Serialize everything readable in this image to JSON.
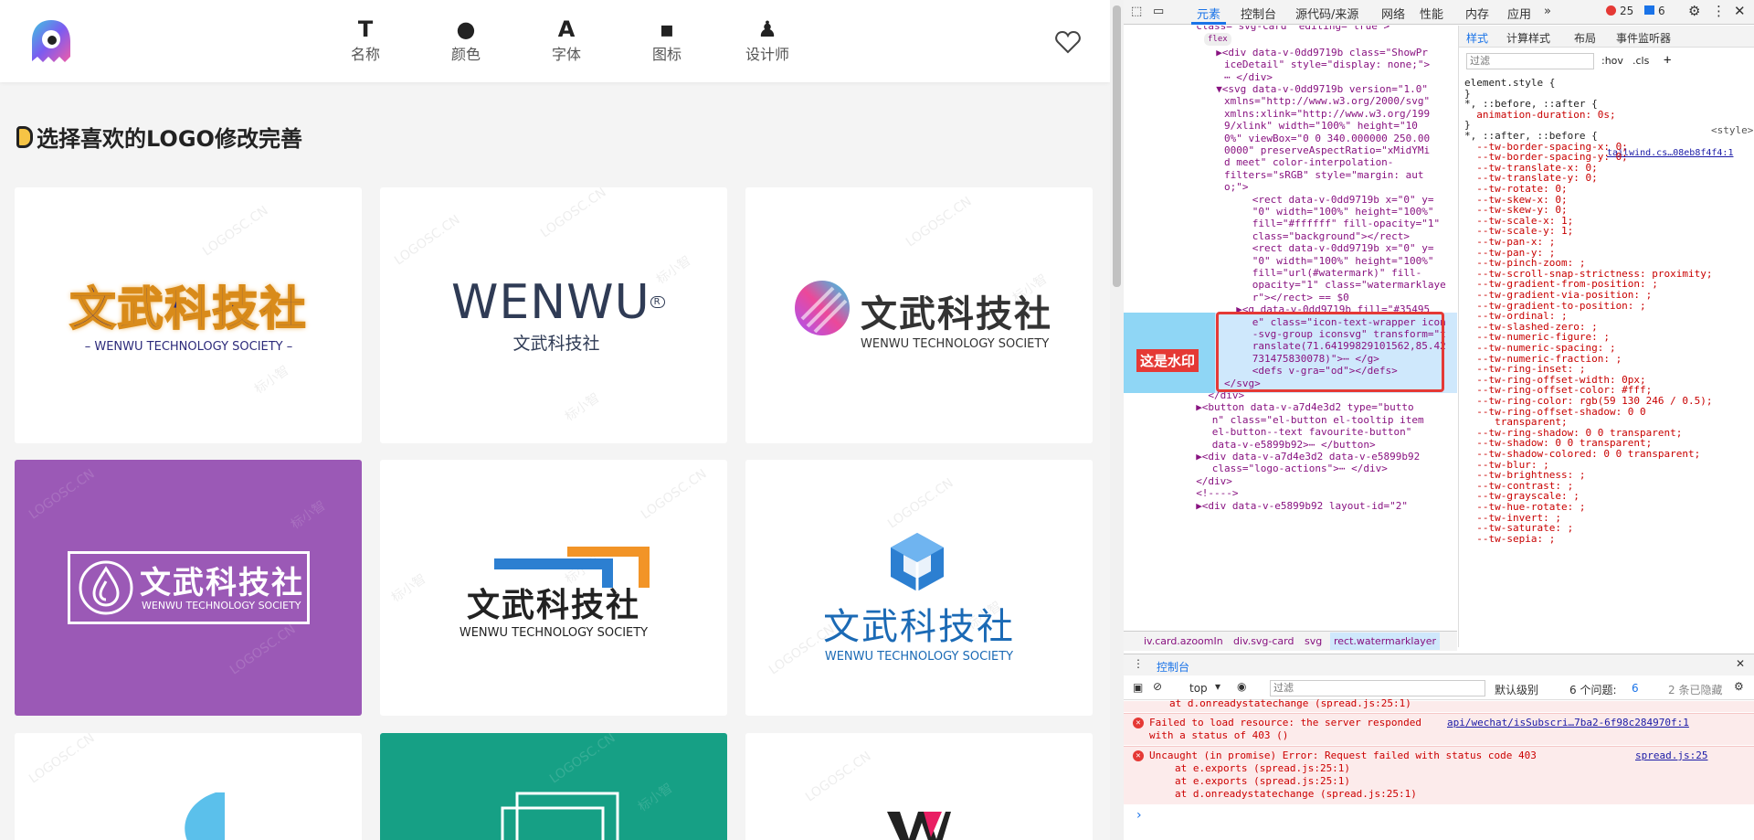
{
  "nav": {
    "items": [
      {
        "icon": "T",
        "label": "名称"
      },
      {
        "icon": "●",
        "label": "颜色"
      },
      {
        "icon": "A",
        "label": "字体"
      },
      {
        "icon": "▪",
        "label": "图标"
      },
      {
        "icon": "♟",
        "label": "设计师"
      }
    ]
  },
  "section": {
    "title": "选择喜欢的LOGO修改完善"
  },
  "watermark": {
    "a": "LOGOSC.CN",
    "b": "标小智"
  },
  "logos": {
    "l1": {
      "cn": "文武科技社",
      "en": "– WENWU TECHNOLOGY SOCIETY –"
    },
    "l2": {
      "brand": "WENWU",
      "reg": "R",
      "cn": "文武科技社"
    },
    "l3": {
      "cn": "文武科技社",
      "en": "WENWU TECHNOLOGY SOCIETY"
    },
    "l4": {
      "cn": "文武科技社",
      "en": "WENWU TECHNOLOGY SOCIETY"
    },
    "l5": {
      "cn": "文武科技社",
      "en": "WENWU TECHNOLOGY SOCIETY"
    },
    "l6": {
      "cn": "文武科技社",
      "en": "WENWU TECHNOLOGY SOCIETY"
    }
  },
  "devtools": {
    "tabs": [
      "元素",
      "控制台",
      "源代码/来源",
      "网络",
      "性能",
      "内存",
      "应用"
    ],
    "more": "»",
    "errors": "25",
    "messages": "6",
    "styles_tabs": [
      "样式",
      "计算样式",
      "布局",
      "事件监听器"
    ],
    "filter_placeholder": "过滤",
    "hov": ":hov",
    "cls": ".cls",
    "watermark_note": "这是水印",
    "code_lines": [
      "class= svg-card  editing= true >",
      "flex",
      "▶<div data-v-0dd9719b class=\"ShowPr",
      "iceDetail\" style=\"display: none;\">",
      "⋯ </div>",
      "▼<svg data-v-0dd9719b version=\"1.0\"",
      "xmlns=\"http://www.w3.org/2000/svg\"",
      "xmlns:xlink=\"http://www.w3.org/199",
      "9/xlink\" width=\"100%\" height=\"10",
      "0%\" viewBox=\"0 0 340.000000 250.00",
      "0000\" preserveAspectRatio=\"xMidYMi",
      "d meet\" color-interpolation-",
      "filters=\"sRGB\" style=\"margin: aut",
      "o;\">",
      "<rect data-v-0dd9719b x=\"0\" y=",
      "\"0\" width=\"100%\" height=\"100%\"",
      "fill=\"#ffffff\" fill-opacity=\"1\"",
      "class=\"background\"></rect>",
      "<rect data-v-0dd9719b x=\"0\" y=",
      "\"0\" width=\"100%\" height=\"100%\"",
      "fill=\"url(#watermark)\" fill-",
      "opacity=\"1\" class=\"watermarklaye",
      "r\"></rect> == $0",
      "▶<g data-v-0dd9719b fill=\"#35495",
      "e\" class=\"icon-text-wrapper icon",
      "-svg-group iconsvg\" transform=\"t",
      "ranslate(71.64199829101562,85.42",
      "731475830078)\">⋯ </g>",
      "<defs v-gra=\"od\"></defs>",
      "</svg>",
      "</div>",
      "▶<button data-v-a7d4e3d2 type=\"butto",
      "n\" class=\"el-button el-tooltip item",
      "el-button--text favourite-button\"",
      "data-v-e5899b92>⋯ </button>",
      "▶<div data-v-a7d4e3d2 data-v-e5899b92",
      "class=\"logo-actions\">⋯ </div>",
      "</div>",
      "<!---->",
      "▶<div data-v-e5899b92 layout-id=\"2\""
    ],
    "style_lines": [
      "element.style {",
      "}",
      "*, ::before, ::after {",
      "  animation-duration: 0s;",
      "}",
      "*, ::after, ::before {",
      "  --tw-border-spacing-x: 0;",
      "  --tw-border-spacing-y: 0;",
      "  --tw-translate-x: 0;",
      "  --tw-translate-y: 0;",
      "  --tw-rotate: 0;",
      "  --tw-skew-x: 0;",
      "  --tw-skew-y: 0;",
      "  --tw-scale-x: 1;",
      "  --tw-scale-y: 1;",
      "  --tw-pan-x: ;",
      "  --tw-pan-y: ;",
      "  --tw-pinch-zoom: ;",
      "  --tw-scroll-snap-strictness: proximity;",
      "  --tw-gradient-from-position: ;",
      "  --tw-gradient-via-position: ;",
      "  --tw-gradient-to-position: ;",
      "  --tw-ordinal: ;",
      "  --tw-slashed-zero: ;",
      "  --tw-numeric-figure: ;",
      "  --tw-numeric-spacing: ;",
      "  --tw-numeric-fraction: ;",
      "  --tw-ring-inset: ;",
      "  --tw-ring-offset-width: 0px;",
      "  --tw-ring-offset-color: #fff;",
      "  --tw-ring-color: rgb(59 130 246 / 0.5);",
      "  --tw-ring-offset-shadow: 0 0",
      "     transparent;",
      "  --tw-ring-shadow: 0 0 transparent;",
      "  --tw-shadow: 0 0 transparent;",
      "  --tw-shadow-colored: 0 0 transparent;",
      "  --tw-blur: ;",
      "  --tw-brightness: ;",
      "  --tw-contrast: ;",
      "  --tw-grayscale: ;",
      "  --tw-hue-rotate: ;",
      "  --tw-invert: ;",
      "  --tw-saturate: ;",
      "  --tw-sepia: ;"
    ],
    "style_source1": "<style>",
    "style_source2": "tailwind.cs…08eb8f4f4:1",
    "crumbs": [
      "iv.card.azoomIn",
      "div.svg-card",
      "svg",
      "rect.watermarklayer"
    ],
    "console": {
      "title": "控制台",
      "context": "top",
      "filter_placeholder": "过滤",
      "level": "默认级别",
      "issues_label": "6 个问题:",
      "issues_count": "6",
      "hidden": "2 条已隐藏",
      "prev_line": "at d.onreadystatechange (spread.js:25:1)",
      "err1_a": "Failed to load resource: the server responded",
      "err1_b": "with a status of 403 ()",
      "err1_src": "api/wechat/isSubscri…7ba2-6f98c284970f:1",
      "err2_a": "Uncaught (in promise) Error: Request failed with status code 403",
      "err2_src": "spread.js:25",
      "err2_b": "at e.exports (spread.js:25:1)",
      "err2_c": "at e.exports (spread.js:25:1)",
      "err2_d": "at d.onreadystatechange (spread.js:25:1)",
      "prompt": "›"
    }
  },
  "colors": {
    "accent": "#1a73e8",
    "error": "#e53935",
    "purple": "#9b59b6",
    "green": "#16a085"
  }
}
